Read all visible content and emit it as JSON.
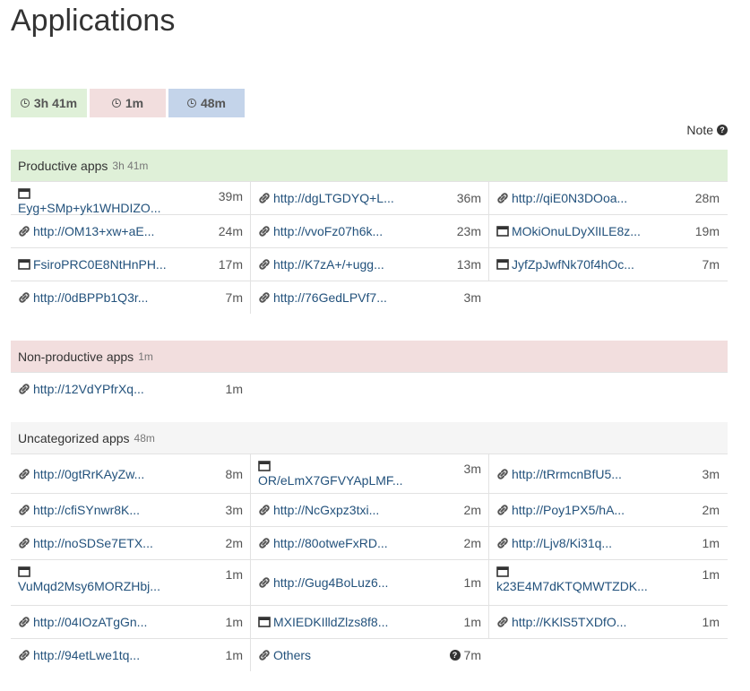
{
  "page": {
    "title": "Applications",
    "note_label": "Note"
  },
  "summary": [
    {
      "time": "3h 41m",
      "color": "#dff0d8"
    },
    {
      "time": "1m",
      "color": "#f2dede"
    },
    {
      "time": "48m",
      "color": "#c4d4ea"
    }
  ],
  "sections": {
    "productive": {
      "label": "Productive apps",
      "total": "3h 41m",
      "color": "#dff0d8",
      "rows": [
        [
          {
            "type": "window",
            "name": "Eyg+SMp+yk1WHDIZO...",
            "time": "39m"
          },
          {
            "type": "link",
            "name": "http://dgLTGDYQ+L...",
            "time": "36m"
          },
          {
            "type": "link",
            "name": "http://qiE0N3DOoa...",
            "time": "28m"
          }
        ],
        [
          {
            "type": "link",
            "name": "http://OM13+xw+aE...",
            "time": "24m"
          },
          {
            "type": "link",
            "name": "http://vvoFz07h6k...",
            "time": "23m"
          },
          {
            "type": "window",
            "name": "MOkiOnuLDyXlILE8z...",
            "time": "19m"
          }
        ],
        [
          {
            "type": "window",
            "name": "FsiroPRC0E8NtHnPH...",
            "time": "17m"
          },
          {
            "type": "link",
            "name": "http://K7zA+/+ugg...",
            "time": "13m"
          },
          {
            "type": "window",
            "name": "JyfZpJwfNk70f4hOc...",
            "time": "7m"
          }
        ],
        [
          {
            "type": "link",
            "name": "http://0dBPPb1Q3r...",
            "time": "7m"
          },
          {
            "type": "link",
            "name": "http://76GedLPVf7...",
            "time": "3m"
          }
        ]
      ]
    },
    "nonproductive": {
      "label": "Non-productive apps",
      "total": "1m",
      "color": "#f2dede",
      "rows": [
        [
          {
            "type": "link",
            "name": "http://12VdYPfrXq...",
            "time": "1m"
          }
        ]
      ]
    },
    "uncategorized": {
      "label": "Uncategorized apps",
      "total": "48m",
      "color": "#f5f5f5",
      "rows": [
        [
          {
            "type": "link",
            "name": "http://0gtRrKAyZw...",
            "time": "8m"
          },
          {
            "type": "window",
            "name": "OR/eLmX7GFVYApLMF...",
            "time": "3m"
          },
          {
            "type": "link",
            "name": "http://tRrmcnBfU5...",
            "time": "3m"
          }
        ],
        [
          {
            "type": "link",
            "name": "http://cfiSYnwr8K...",
            "time": "3m"
          },
          {
            "type": "link",
            "name": "http://NcGxpz3txi...",
            "time": "2m"
          },
          {
            "type": "link",
            "name": "http://Poy1PX5/hA...",
            "time": "2m"
          }
        ],
        [
          {
            "type": "link",
            "name": "http://noSDSe7ETX...",
            "time": "2m"
          },
          {
            "type": "link",
            "name": "http://80otweFxRD...",
            "time": "2m"
          },
          {
            "type": "link",
            "name": "http://Ljv8/Ki31q...",
            "time": "1m"
          }
        ],
        [
          {
            "type": "window",
            "name": "VuMqd2Msy6MORZHbj...",
            "time": "1m"
          },
          {
            "type": "link",
            "name": "http://Gug4BoLuz6...",
            "time": "1m"
          },
          {
            "type": "window",
            "name": "k23E4M7dKTQMWTZDK...",
            "time": "1m"
          }
        ],
        [
          {
            "type": "link",
            "name": "http://04IOzATgGn...",
            "time": "1m"
          },
          {
            "type": "window",
            "name": "MXIEDKIlldZlzs8f8...",
            "time": "1m"
          },
          {
            "type": "link",
            "name": "http://KKlS5TXDfO...",
            "time": "1m"
          }
        ],
        [
          {
            "type": "link",
            "name": "http://94etLwe1tq...",
            "time": "1m"
          },
          {
            "type": "others",
            "name": "Others",
            "time": "7m"
          }
        ]
      ]
    }
  }
}
